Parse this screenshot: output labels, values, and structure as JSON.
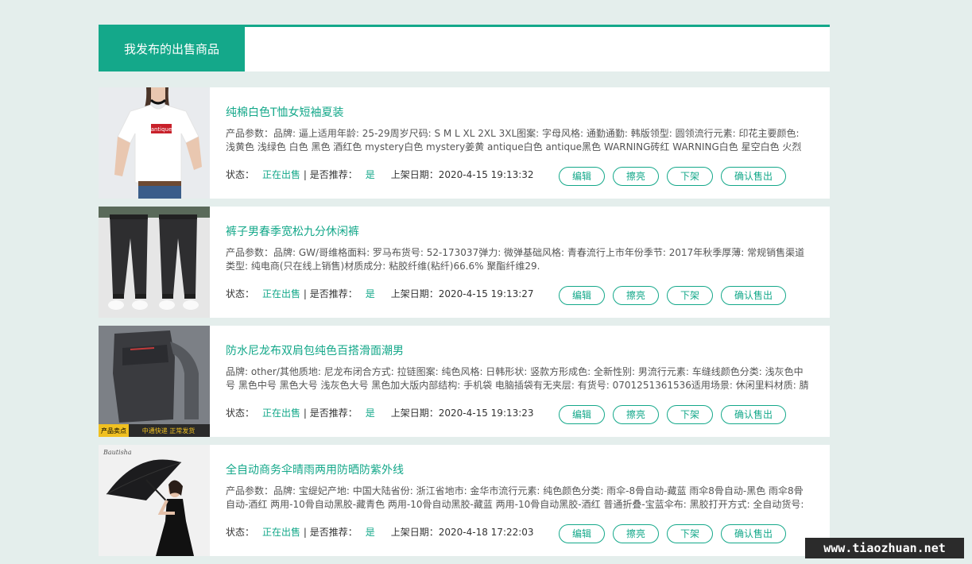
{
  "header": {
    "title": "我发布的出售商品"
  },
  "labels": {
    "status": "状态：",
    "recommend": " | 是否推荐：",
    "date": "上架日期：",
    "edit": "编辑",
    "polish": "擦亮",
    "delist": "下架",
    "sold": "确认售出"
  },
  "items": [
    {
      "title": "纯棉白色T恤女短袖夏装",
      "params": "产品参数：品牌: 逼上适用年龄: 25-29周岁尺码: S M L XL 2XL 3XL图案: 字母风格: 通勤通勤: 韩版领型: 圆领流行元素: 印花主要颜色: 浅黄色 浅绿色 白色 黑色 酒红色 mystery白色 mystery姜黄 antique白色 antique黑色 WARNING砖红 WARNING白色 星空白色 火烈鸟白色",
      "status": "正在出售",
      "recommend": "是",
      "date": "2020-4-15 19:13:32"
    },
    {
      "title": "裤子男春季宽松九分休闲裤",
      "params": "产品参数：品牌: GW/哥维格面料: 罗马布货号: 52-173037弹力: 微弹基础风格: 青春流行上市年份季节: 2017年秋季厚薄: 常规销售渠道类型: 纯电商(只在线上销售)材质成分: 粘胶纤维(粘纤)66.6% 聚酯纤维29.",
      "status": "正在出售",
      "recommend": "是",
      "date": "2020-4-15 19:13:27"
    },
    {
      "title": "防水尼龙布双肩包纯色百搭滑面潮男",
      "params": "品牌: other/其他质地: 尼龙布闭合方式: 拉链图案: 纯色风格: 日韩形状: 竖款方形成色: 全新性别: 男流行元素: 车缝线颜色分类: 浅灰色中号 黑色中号 黑色大号 浅灰色大号 黑色加大版内部结构: 手机袋 电脑插袋有无夹层: 有货号: 0701251361536适用场景: 休闲里料材质: 腈纶肩带样",
      "status": "正在出售",
      "recommend": "是",
      "date": "2020-4-15 19:13:23",
      "badge_left": "产品卖点",
      "badge_right": "中通快递  正常发货"
    },
    {
      "title": "全自动商务伞晴雨两用防晒防紫外线",
      "params": "产品参数：品牌: 宝缇妃产地: 中国大陆省份: 浙江省地市: 金华市流行元素: 纯色颜色分类: 雨伞-8骨自动-藏蓝 雨伞8骨自动-黑色 雨伞8骨自动-酒红 两用-10骨自动黑胶-藏青色 两用-10骨自动黑胶-藏蓝 两用-10骨自动黑胶-酒红 普通折叠-宝蓝伞布: 黑胶打开方式: 全自动货号: A-",
      "status": "正在出售",
      "recommend": "是",
      "date": "2020-4-18 17:22:03",
      "logo": "Bautisha"
    }
  ],
  "watermark": "www.tiaozhuan.net",
  "colors": {
    "accent": "#14a88a",
    "background": "#e4eeec"
  }
}
